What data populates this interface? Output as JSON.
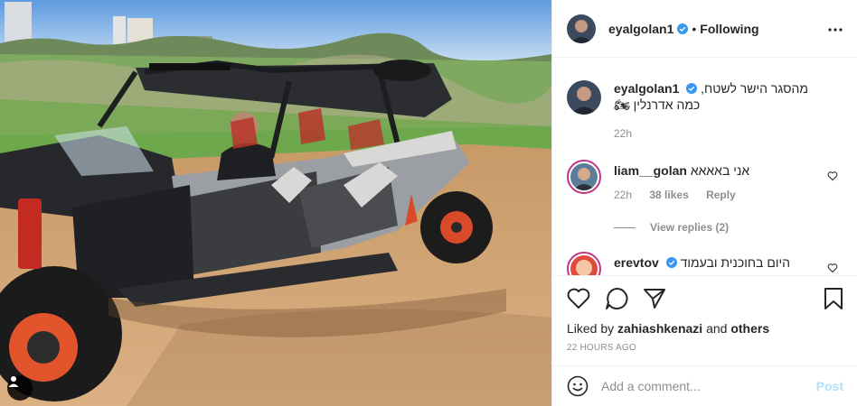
{
  "post": {
    "author": {
      "username": "eyalgolan1",
      "verified": true,
      "follow_status": "Following",
      "dot": "•"
    },
    "caption": {
      "username": "eyalgolan1",
      "line1": "מהסגר הישר לשטח,",
      "line2": "כמה אדרנלין 🏍",
      "age": "22h"
    },
    "comments": [
      {
        "username": "liam__golan",
        "text": "אני באאאא",
        "age": "22h",
        "likes": "38 likes",
        "reply_label": "Reply",
        "view_replies": "View replies (2)"
      },
      {
        "username": "erevtov",
        "verified": true,
        "text": "היום בחוכנית ובעמוד"
      }
    ],
    "liked_by": {
      "prefix": "Liked by",
      "user": "zahiashkenazi",
      "and": "and",
      "others": "others"
    },
    "timestamp": "22 HOURS AGO",
    "add_comment": {
      "placeholder": "Add a comment...",
      "post_label": "Post"
    }
  },
  "icons": {
    "verified": "verified-badge-icon",
    "more": "more-options-icon",
    "like": "heart-icon",
    "comment": "comment-icon",
    "share": "share-icon",
    "save": "bookmark-icon",
    "emoji": "emoji-icon",
    "tag": "user-tag-icon"
  },
  "colors": {
    "verified_blue": "#3897f0",
    "post_button_disabled": "#b2dffc",
    "muted_text": "#8e8e8e"
  }
}
